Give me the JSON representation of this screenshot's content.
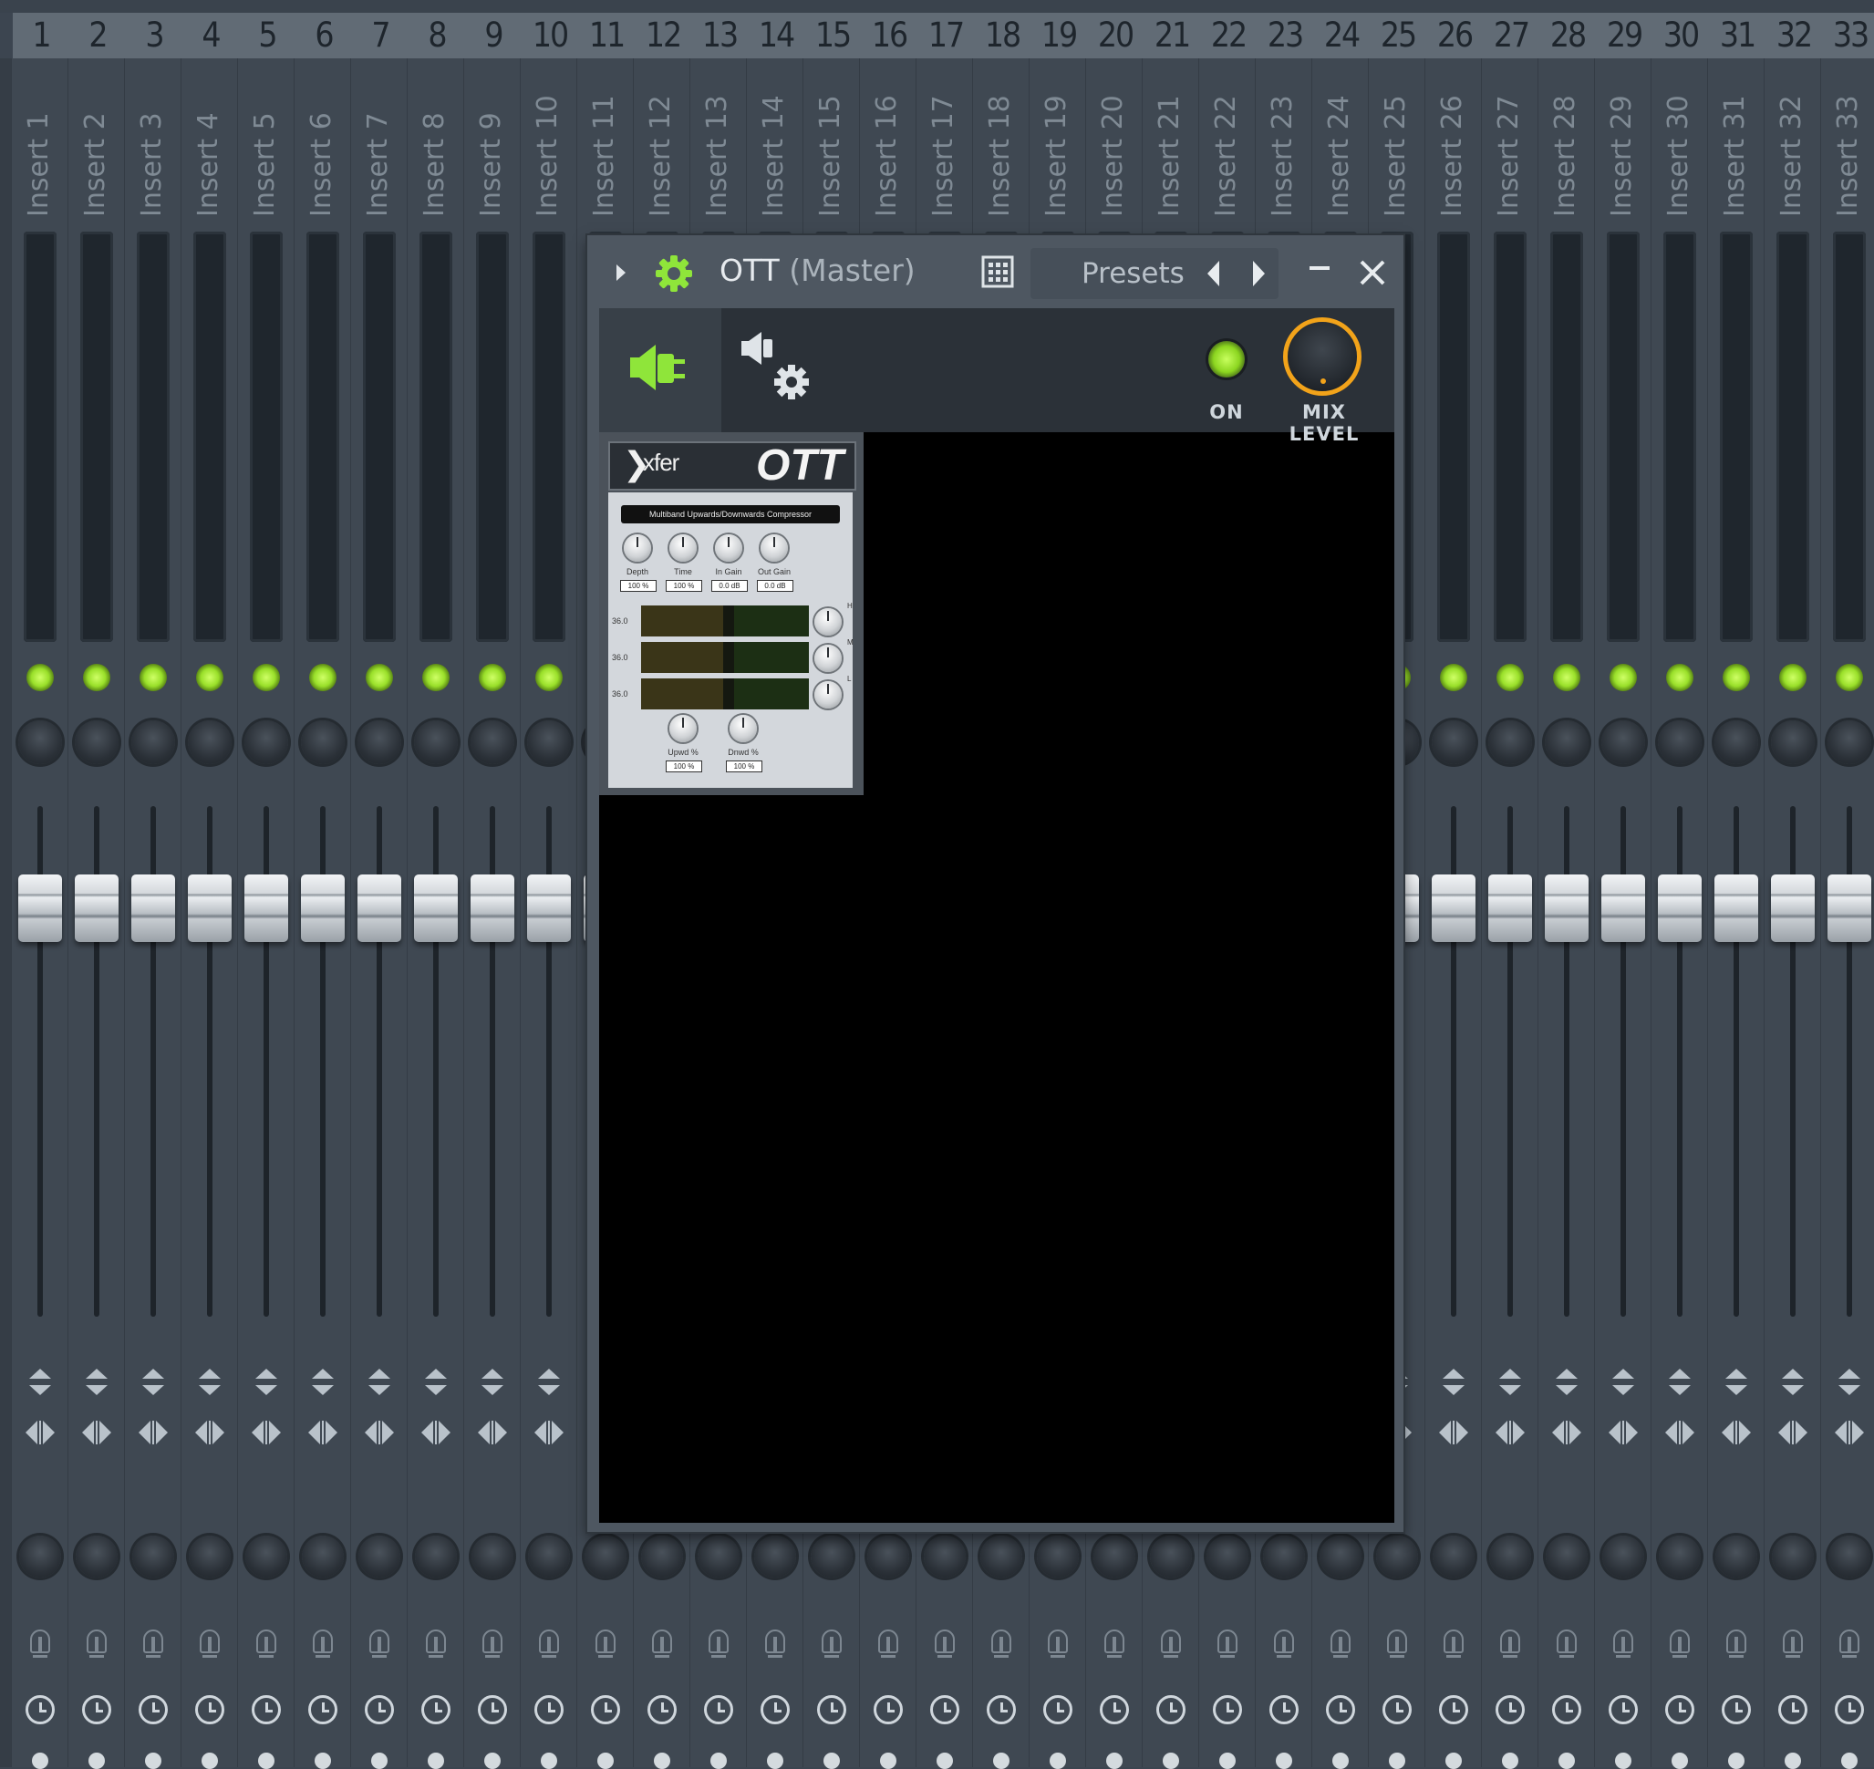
{
  "mixer": {
    "track_numbers": [
      "1",
      "2",
      "3",
      "4",
      "5",
      "6",
      "7",
      "8",
      "9",
      "10",
      "11",
      "12",
      "13",
      "14",
      "15",
      "16",
      "17",
      "18",
      "19",
      "20",
      "21",
      "22",
      "23",
      "24",
      "25",
      "26",
      "27",
      "28",
      "29",
      "30",
      "31",
      "32",
      "33"
    ],
    "insert_names": [
      "Insert 1",
      "Insert 2",
      "Insert 3",
      "Insert 4",
      "Insert 5",
      "Insert 6",
      "Insert 7",
      "Insert 8",
      "Insert 9",
      "Insert 10",
      "Insert 11",
      "Insert 12",
      "Insert 13",
      "Insert 14",
      "Insert 15",
      "Insert 16",
      "Insert 17",
      "Insert 18",
      "Insert 19",
      "Insert 20",
      "Insert 21",
      "Insert 22",
      "Insert 23",
      "Insert 24",
      "Insert 25",
      "Insert 26",
      "Insert 27",
      "Insert 28",
      "Insert 29",
      "Insert 30",
      "Insert 31",
      "Insert 32",
      "Insert 33"
    ],
    "colors": {
      "led_on": "#9ae02a",
      "accent": "#f2a31a"
    }
  },
  "plugin_window": {
    "title": "OTT",
    "title_suffix": "(Master)",
    "presets_label": "Presets",
    "on_label": "ON",
    "mix_level_label": "MIX LEVEL",
    "icons": {
      "expand": "triangle-right-icon",
      "gear": "gear-icon",
      "grid": "grid-icon",
      "minimize": "minimize-icon",
      "close": "close-icon",
      "plugin_tab": "speaker-plug-icon",
      "settings_tab": "speaker-gear-icon"
    },
    "ott": {
      "brand": "xfer",
      "name": "OTT",
      "subtitle": "Multiband Upwards/Downwards Compressor",
      "knobs": [
        {
          "label": "Depth",
          "value": "100 %"
        },
        {
          "label": "Time",
          "value": "100 %"
        },
        {
          "label": "In Gain",
          "value": "0.0 dB"
        },
        {
          "label": "Out Gain",
          "value": "0.0 dB"
        }
      ],
      "bands": [
        {
          "value": "36.0",
          "label": "H"
        },
        {
          "value": "36.0",
          "label": "M"
        },
        {
          "value": "36.0",
          "label": "L"
        }
      ],
      "bottom_knobs": [
        {
          "label": "Upwd %",
          "value": "100 %"
        },
        {
          "label": "Dnwd %",
          "value": "100 %"
        }
      ]
    }
  }
}
